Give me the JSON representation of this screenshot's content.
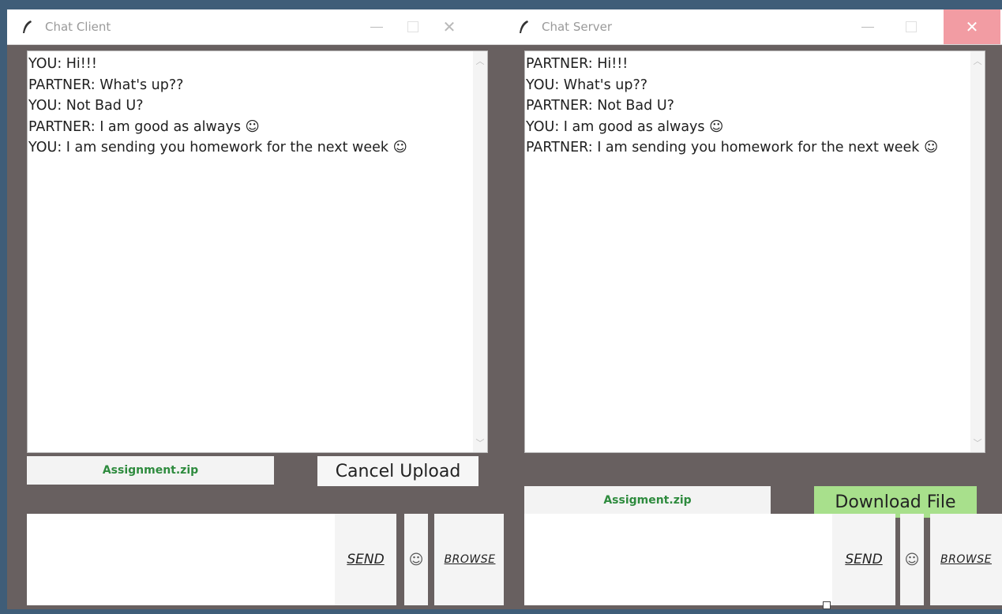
{
  "client": {
    "title": "Chat Client",
    "messages": [
      "YOU: Hi!!!",
      "PARTNER: What's up??",
      "YOU: Not Bad U?",
      "PARTNER: I am good as always ☺",
      "YOU: I am sending you homework for the next week ☺"
    ],
    "file_name": "Assignment.zip",
    "cancel_label": "Cancel Upload",
    "send_label": "SEND",
    "emoji_glyph": "☺",
    "browse_label": "BROWSE"
  },
  "server": {
    "title": "Chat Server",
    "messages": [
      "PARTNER: Hi!!!",
      "YOU: What's up??",
      "PARTNER: Not Bad U?",
      "YOU: I am good as always ☺",
      "PARTNER: I am sending you homework for the next week ☺"
    ],
    "file_name": "Assigment.zip",
    "download_label": "Download File",
    "send_label": "SEND",
    "emoji_glyph": "☺",
    "browse_label": "BROWSE"
  },
  "colors": {
    "window_bg": "#686060",
    "file_name_text": "#2e8b3e",
    "download_button": "#a8e08c",
    "close_hover": "#f29ca3"
  },
  "icons": [
    "feather-icon",
    "minimize-icon",
    "maximize-icon",
    "close-icon",
    "scroll-up-icon",
    "scroll-down-icon",
    "emoji-icon"
  ]
}
